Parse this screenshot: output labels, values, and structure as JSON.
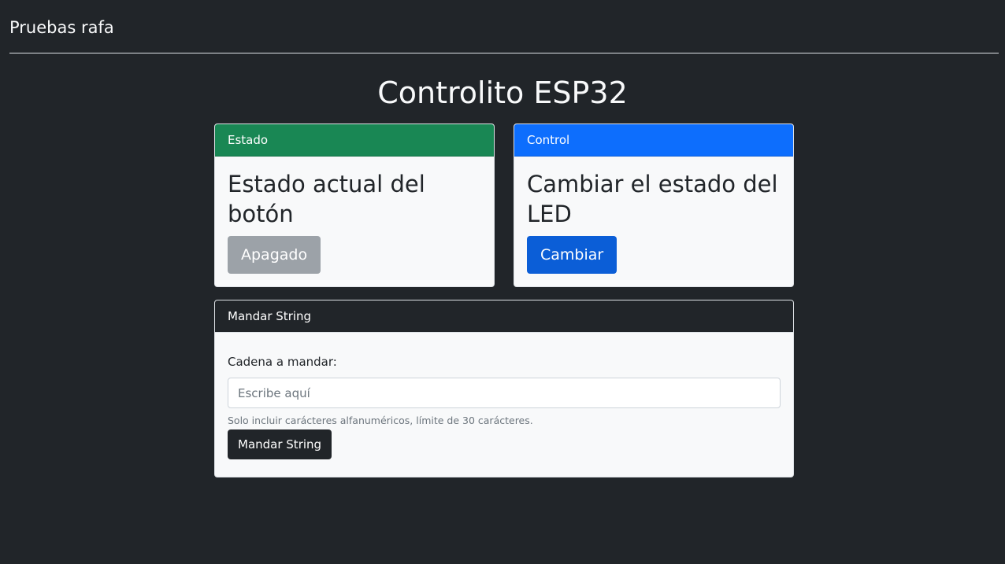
{
  "navbar": {
    "brand": "Pruebas rafa"
  },
  "page": {
    "title": "Controlito ESP32"
  },
  "estado_card": {
    "header": "Estado",
    "header_color": "#198754",
    "title": "Estado actual del botón",
    "button_label": "Apagado"
  },
  "control_card": {
    "header": "Control",
    "header_color": "#0d6efd",
    "title": "Cambiar el estado del LED",
    "button_label": "Cambiar"
  },
  "string_card": {
    "header": "Mandar String",
    "header_color": "#212529",
    "field_label": "Cadena a mandar:",
    "input_value": "",
    "input_placeholder": "Escribe aquí",
    "help_text": "Solo incluir carácteres alfanuméricos, límite de 30 carácteres.",
    "button_label": "Mandar String"
  }
}
